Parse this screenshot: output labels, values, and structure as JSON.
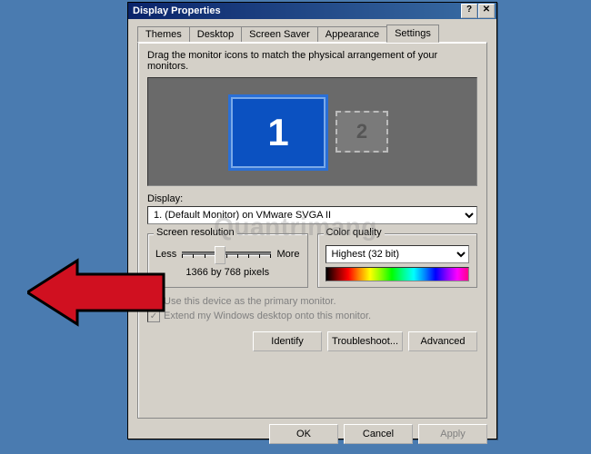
{
  "window": {
    "title": "Display Properties"
  },
  "tabs": {
    "themes": "Themes",
    "desktop": "Desktop",
    "screensaver": "Screen Saver",
    "appearance": "Appearance",
    "settings": "Settings"
  },
  "settings_panel": {
    "instruction": "Drag the monitor icons to match the physical arrangement of your monitors.",
    "monitor1": "1",
    "monitor2": "2",
    "display_label": "Display:",
    "display_selected": "1. (Default Monitor) on VMware SVGA II",
    "screen_res_label": "Screen resolution",
    "less": "Less",
    "more": "More",
    "resolution_text": "1366 by 768 pixels",
    "color_quality_label": "Color quality",
    "color_quality_selected": "Highest (32 bit)",
    "chk_primary": "Use this device as the primary monitor.",
    "chk_extend": "Extend my Windows desktop onto this monitor.",
    "identify": "Identify",
    "troubleshoot": "Troubleshoot...",
    "advanced": "Advanced"
  },
  "buttons": {
    "ok": "OK",
    "cancel": "Cancel",
    "apply": "Apply"
  },
  "watermark": "Quantrimang"
}
